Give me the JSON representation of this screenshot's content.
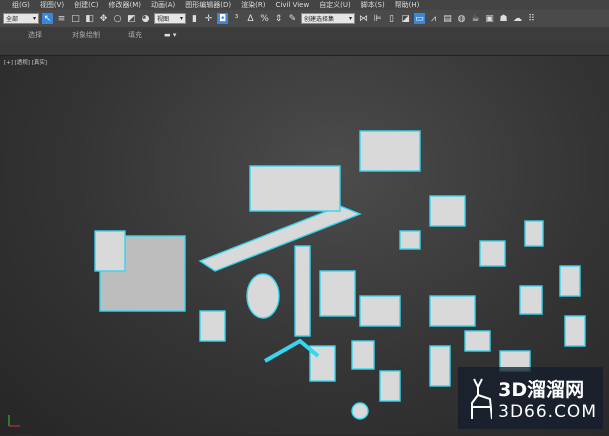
{
  "menu": [
    "组(G)",
    "视图(V)",
    "创建(C)",
    "修改器(M)",
    "动画(A)",
    "图形编辑器(D)",
    "渲染(R)",
    "Civil View",
    "自定义(U)",
    "脚本(S)",
    "帮助(H)"
  ],
  "toolbar": {
    "selection_filter": "全部",
    "reference_coord": "视图",
    "named_selection": "创建选择集"
  },
  "ribbon": {
    "tabs": [
      "选择",
      "对象绘制",
      "填充"
    ]
  },
  "viewport": {
    "label": "[+] [透视] [真实]"
  },
  "watermark": {
    "title": "3D溜溜网",
    "url": "3D66.COM"
  },
  "colors": {
    "accent": "#3d86d6",
    "outline": "#35d6f0"
  }
}
